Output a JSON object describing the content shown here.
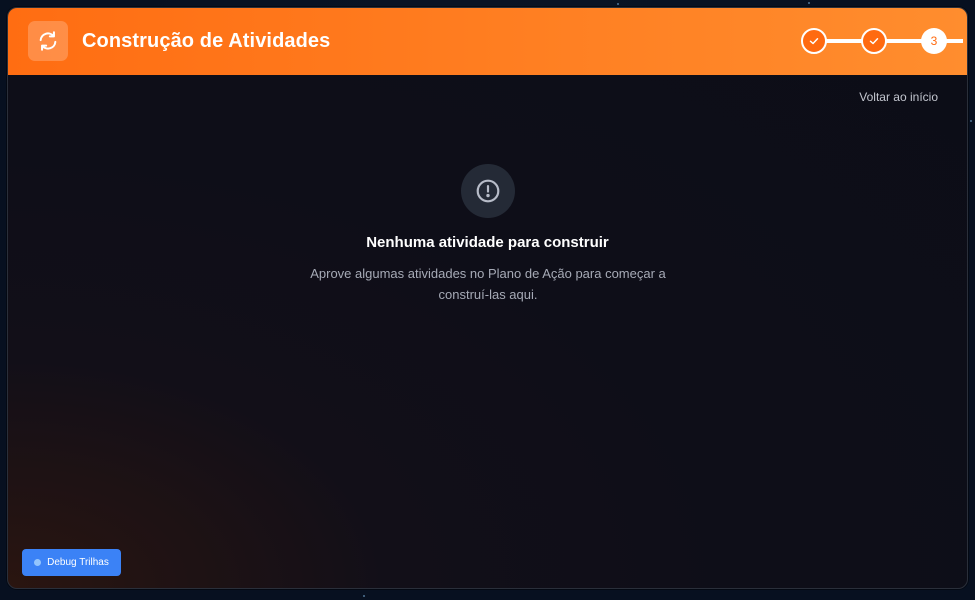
{
  "header": {
    "title": "Construção de Atividades",
    "icon": "refresh-icon",
    "accent_color": "#ff6d12"
  },
  "stepper": {
    "steps": [
      {
        "state": "completed",
        "icon": "check-icon"
      },
      {
        "state": "completed",
        "icon": "check-icon"
      },
      {
        "state": "current",
        "label": "3"
      }
    ]
  },
  "navigation": {
    "back_label": "Voltar ao início"
  },
  "empty_state": {
    "icon": "alert-circle-icon",
    "title": "Nenhuma atividade para construir",
    "description": "Aprove algumas atividades no Plano de Ação para começar a construí-las aqui."
  },
  "debug": {
    "label": "Debug Trilhas",
    "color": "#3b82f6"
  }
}
